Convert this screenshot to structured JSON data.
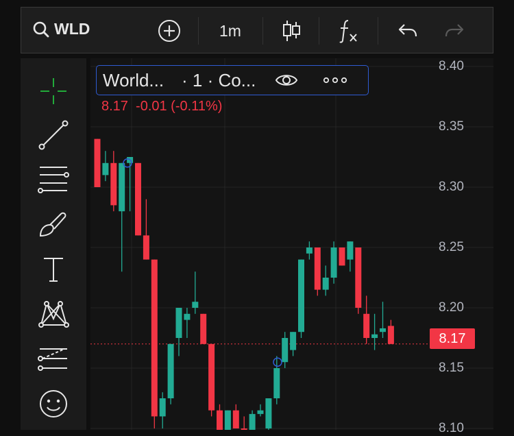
{
  "toolbar": {
    "symbol": "WLD",
    "interval": "1m",
    "icons": [
      "search-icon",
      "add-symbol-icon",
      "candles-icon",
      "indicators-icon",
      "undo-icon",
      "redo-icon"
    ]
  },
  "sidebar": {
    "tools": [
      "crosshair-icon",
      "trend-line-icon",
      "fib-levels-icon",
      "brush-icon",
      "text-tool-icon",
      "pattern-icon",
      "projection-icon",
      "emoji-icon"
    ]
  },
  "legend": {
    "name": "World...",
    "meta": "· 1 · Co...",
    "quote": "8.17  -0.01 (-0.11%)"
  },
  "price_axis": {
    "labels": [
      "8.40",
      "8.35",
      "8.30",
      "8.25",
      "8.20",
      "8.15",
      "8.10"
    ],
    "last_price": "8.17"
  },
  "colors": {
    "up": "#22ab94",
    "down": "#f23645",
    "accent": "#2f5bd3"
  },
  "chart_data": {
    "type": "candlestick",
    "ylim": [
      8.095,
      8.405
    ],
    "last_price": 8.17,
    "candles": [
      {
        "o": 8.34,
        "h": 8.34,
        "l": 8.3,
        "c": 8.3
      },
      {
        "o": 8.31,
        "h": 8.33,
        "l": 8.305,
        "c": 8.32
      },
      {
        "o": 8.32,
        "h": 8.33,
        "l": 8.28,
        "c": 8.285
      },
      {
        "o": 8.28,
        "h": 8.32,
        "l": 8.23,
        "c": 8.32
      },
      {
        "o": 8.32,
        "h": 8.325,
        "l": 8.28,
        "c": 8.325
      },
      {
        "o": 8.32,
        "h": 8.32,
        "l": 8.26,
        "c": 8.26
      },
      {
        "o": 8.26,
        "h": 8.29,
        "l": 8.24,
        "c": 8.24
      },
      {
        "o": 8.24,
        "h": 8.24,
        "l": 8.1,
        "c": 8.11
      },
      {
        "o": 8.11,
        "h": 8.13,
        "l": 8.1,
        "c": 8.125
      },
      {
        "o": 8.125,
        "h": 8.17,
        "l": 8.12,
        "c": 8.17
      },
      {
        "o": 8.175,
        "h": 8.2,
        "l": 8.16,
        "c": 8.2
      },
      {
        "o": 8.19,
        "h": 8.2,
        "l": 8.175,
        "c": 8.195
      },
      {
        "o": 8.2,
        "h": 8.23,
        "l": 8.195,
        "c": 8.205
      },
      {
        "o": 8.195,
        "h": 8.195,
        "l": 8.17,
        "c": 8.17
      },
      {
        "o": 8.17,
        "h": 8.17,
        "l": 8.11,
        "c": 8.115
      },
      {
        "o": 8.115,
        "h": 8.12,
        "l": 8.09,
        "c": 8.09
      },
      {
        "o": 8.09,
        "h": 8.115,
        "l": 8.085,
        "c": 8.115
      },
      {
        "o": 8.115,
        "h": 8.12,
        "l": 8.1,
        "c": 8.1
      },
      {
        "o": 8.1,
        "h": 8.11,
        "l": 8.085,
        "c": 8.095
      },
      {
        "o": 8.098,
        "h": 8.115,
        "l": 8.095,
        "c": 8.112
      },
      {
        "o": 8.112,
        "h": 8.12,
        "l": 8.11,
        "c": 8.115
      },
      {
        "o": 8.1,
        "h": 8.125,
        "l": 8.095,
        "c": 8.125
      },
      {
        "o": 8.125,
        "h": 8.16,
        "l": 8.12,
        "c": 8.15
      },
      {
        "o": 8.155,
        "h": 8.18,
        "l": 8.15,
        "c": 8.175
      },
      {
        "o": 8.165,
        "h": 8.18,
        "l": 8.16,
        "c": 8.18
      },
      {
        "o": 8.18,
        "h": 8.24,
        "l": 8.175,
        "c": 8.24
      },
      {
        "o": 8.245,
        "h": 8.255,
        "l": 8.24,
        "c": 8.25
      },
      {
        "o": 8.25,
        "h": 8.25,
        "l": 8.21,
        "c": 8.215
      },
      {
        "o": 8.215,
        "h": 8.235,
        "l": 8.21,
        "c": 8.225
      },
      {
        "o": 8.225,
        "h": 8.255,
        "l": 8.22,
        "c": 8.25
      },
      {
        "o": 8.25,
        "h": 8.25,
        "l": 8.235,
        "c": 8.235
      },
      {
        "o": 8.24,
        "h": 8.255,
        "l": 8.23,
        "c": 8.255
      },
      {
        "o": 8.25,
        "h": 8.25,
        "l": 8.195,
        "c": 8.2
      },
      {
        "o": 8.195,
        "h": 8.21,
        "l": 8.17,
        "c": 8.175
      },
      {
        "o": 8.175,
        "h": 8.195,
        "l": 8.165,
        "c": 8.178
      },
      {
        "o": 8.18,
        "h": 8.205,
        "l": 8.175,
        "c": 8.183
      },
      {
        "o": 8.185,
        "h": 8.19,
        "l": 8.17,
        "c": 8.17
      }
    ]
  }
}
